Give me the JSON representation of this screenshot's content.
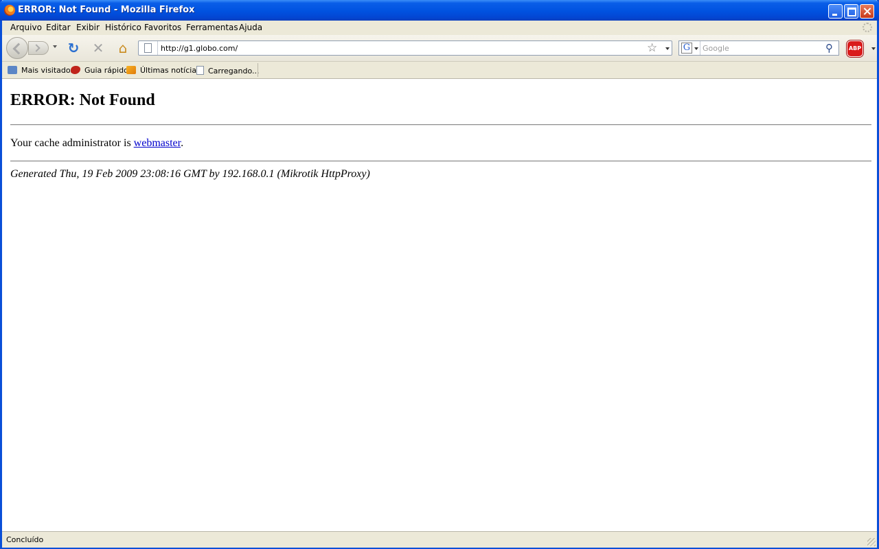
{
  "window": {
    "title": "ERROR: Not Found - Mozilla Firefox"
  },
  "menu": {
    "items": [
      "Arquivo",
      "Editar",
      "Exibir",
      "Histórico",
      "Favoritos",
      "Ferramentas",
      "Ajuda"
    ]
  },
  "nav": {
    "url": "http://g1.globo.com/",
    "search_placeholder": "Google",
    "search_engine_icon": "G",
    "abp_label": "ABP"
  },
  "bookmarks": {
    "items": [
      "Mais visitados",
      "Guia rápido",
      "Últimas notícias",
      "Carregando..."
    ]
  },
  "page": {
    "heading": "ERROR: Not Found",
    "admin_prefix": "Your cache administrator is ",
    "admin_link": "webmaster",
    "admin_suffix": ".",
    "generated": "Generated Thu, 19 Feb 2009 23:08:16 GMT by 192.168.0.1 (Mikrotik HttpProxy)"
  },
  "status": {
    "text": "Concluído"
  }
}
